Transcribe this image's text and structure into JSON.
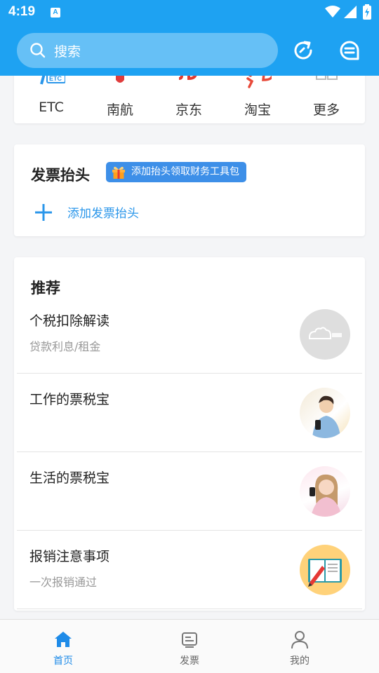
{
  "status_bar": {
    "time": "4:19",
    "notification_icon": "A"
  },
  "search": {
    "placeholder": "搜索"
  },
  "header_icons": [
    "refresh-icon",
    "message-icon"
  ],
  "quick_actions": [
    {
      "label": "ETC",
      "icon": "etc-icon"
    },
    {
      "label": "南航",
      "icon": "china-southern-icon"
    },
    {
      "label": "京东",
      "icon": "jd-icon"
    },
    {
      "label": "淘宝",
      "icon": "taobao-icon"
    },
    {
      "label": "更多",
      "icon": "more-grid-icon"
    }
  ],
  "invoice_header": {
    "title": "发票抬头",
    "promo": "添加抬头领取财务工具包",
    "add_label": "添加发票抬头"
  },
  "recommend": {
    "title": "推荐",
    "items": [
      {
        "title": "个税扣除解读",
        "subtitle": "贷款利息/租金"
      },
      {
        "title": "工作的票税宝",
        "subtitle": ""
      },
      {
        "title": "生活的票税宝",
        "subtitle": ""
      },
      {
        "title": "报销注意事项",
        "subtitle": "一次报销通过"
      }
    ]
  },
  "bottom_nav": [
    {
      "label": "首页",
      "icon": "home-icon",
      "active": true
    },
    {
      "label": "发票",
      "icon": "invoice-icon",
      "active": false
    },
    {
      "label": "我的",
      "icon": "profile-icon",
      "active": false
    }
  ],
  "colors": {
    "primary": "#1ea2f2",
    "link": "#2a96ea",
    "promo": "#3d8fe8",
    "active_nav": "#1e8be8"
  }
}
